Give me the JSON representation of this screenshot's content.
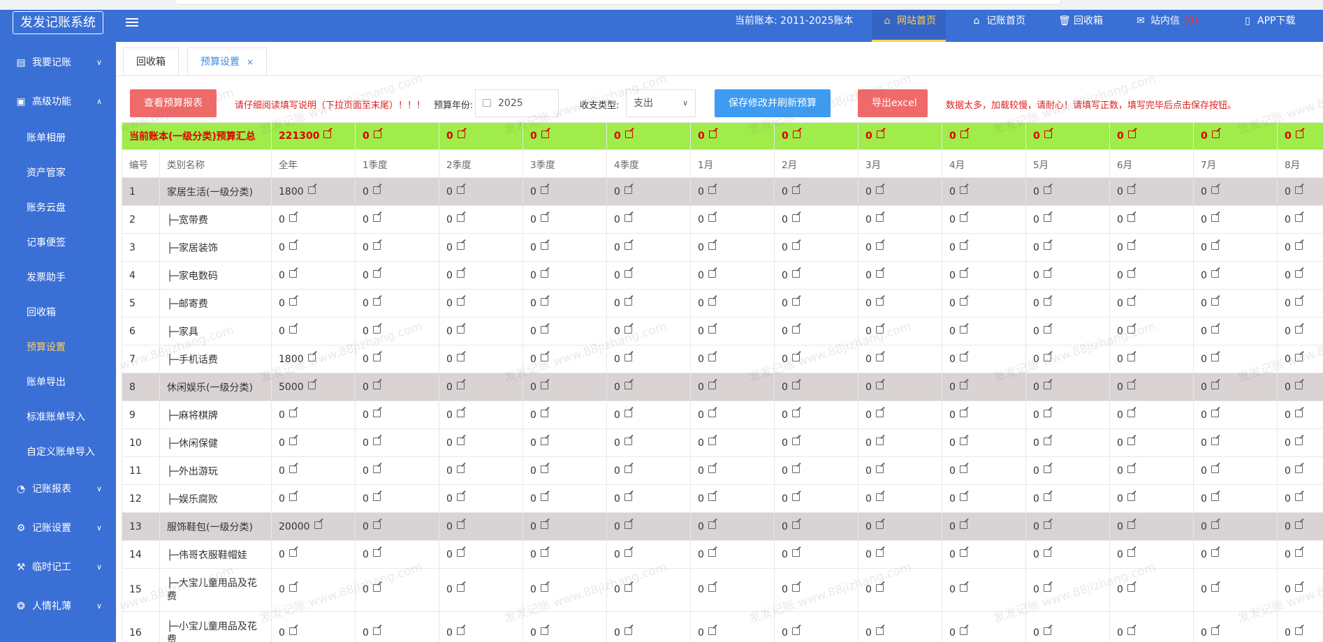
{
  "app": {
    "logo": "发发记账系统"
  },
  "top_nav": {
    "current_book_label": "当前账本:",
    "current_book": "2011-2025账本",
    "items": [
      {
        "label": "网站首页",
        "icon": "home-icon",
        "active": true
      },
      {
        "label": "记账首页",
        "icon": "home-icon"
      },
      {
        "label": "回收箱",
        "icon": "trash-icon"
      },
      {
        "label": "站内信",
        "icon": "mail-icon",
        "badge": "(0)"
      },
      {
        "label": "APP下载",
        "icon": "phone-icon"
      }
    ]
  },
  "sidebar": {
    "groups": [
      {
        "label": "我要记账",
        "icon": "ledger-icon",
        "chevron": "chevron-down-icon"
      },
      {
        "label": "高级功能",
        "icon": "briefcase-icon",
        "chevron": "chevron-up-icon"
      },
      {
        "label": "记账报表",
        "icon": "pie-chart-icon",
        "chevron": "chevron-down-icon"
      },
      {
        "label": "记账设置",
        "icon": "gear-icon",
        "chevron": "chevron-down-icon"
      },
      {
        "label": "临时记工",
        "icon": "tools-icon",
        "chevron": "chevron-down-icon"
      },
      {
        "label": "人情礼薄",
        "icon": "gift-icon",
        "chevron": "chevron-down-icon"
      }
    ],
    "sub_items": [
      "账单相册",
      "资产管家",
      "账务云盘",
      "记事便签",
      "发票助手",
      "回收箱",
      "预算设置",
      "账单导出",
      "标准账单导入",
      "自定义账单导入"
    ],
    "active_sub": "预算设置"
  },
  "tabs": [
    {
      "label": "回收箱"
    },
    {
      "label": "预算设置",
      "active": true,
      "close": "×"
    }
  ],
  "toolbar": {
    "view_report_btn": "查看预算报表",
    "tip1": "请仔细阅读填写说明（下拉页面至末尾）！！！",
    "year_label": "预算年份:",
    "year_value": "2025",
    "type_label": "收支类型:",
    "type_value": "支出",
    "save_btn": "保存修改并刷新预算",
    "export_btn": "导出excel",
    "tip2": "数据太多，加载较慢，请耐心！请填写正数，填写完毕后点击保存按钮。"
  },
  "table": {
    "summary": {
      "label": "当前账本(一级分类)预算汇总",
      "values": [
        "221300",
        "0",
        "0",
        "0",
        "0",
        "0",
        "0",
        "0",
        "0",
        "0",
        "0",
        "0",
        "0"
      ]
    },
    "headers": [
      "编号",
      "类别名称",
      "全年",
      "1季度",
      "2季度",
      "3季度",
      "4季度",
      "1月",
      "2月",
      "3月",
      "4月",
      "5月",
      "6月",
      "7月",
      "8月"
    ],
    "rows": [
      {
        "id": "1",
        "name": "家居生活(一级分类)",
        "year": "1800",
        "group": true
      },
      {
        "id": "2",
        "name": "├─宽带费",
        "year": "0"
      },
      {
        "id": "3",
        "name": "├─家居装饰",
        "year": "0"
      },
      {
        "id": "4",
        "name": "├─家电数码",
        "year": "0"
      },
      {
        "id": "5",
        "name": "├─邮寄费",
        "year": "0"
      },
      {
        "id": "6",
        "name": "├─家具",
        "year": "0"
      },
      {
        "id": "7",
        "name": "├─手机话费",
        "year": "1800"
      },
      {
        "id": "8",
        "name": "休闲娱乐(一级分类)",
        "year": "5000",
        "group": true
      },
      {
        "id": "9",
        "name": "├─麻将棋牌",
        "year": "0"
      },
      {
        "id": "10",
        "name": "├─休闲保健",
        "year": "0"
      },
      {
        "id": "11",
        "name": "├─外出游玩",
        "year": "0"
      },
      {
        "id": "12",
        "name": "├─娱乐腐败",
        "year": "0"
      },
      {
        "id": "13",
        "name": "服饰鞋包(一级分类)",
        "year": "20000",
        "group": true
      },
      {
        "id": "14",
        "name": "├─伟哥衣服鞋帽娃",
        "year": "0"
      },
      {
        "id": "15",
        "name": "├─大宝儿童用品及花费",
        "year": "0",
        "tall": true
      },
      {
        "id": "16",
        "name": "├─小宝儿童用品及花费",
        "year": "0",
        "tall": true
      }
    ],
    "period_value": "0"
  }
}
